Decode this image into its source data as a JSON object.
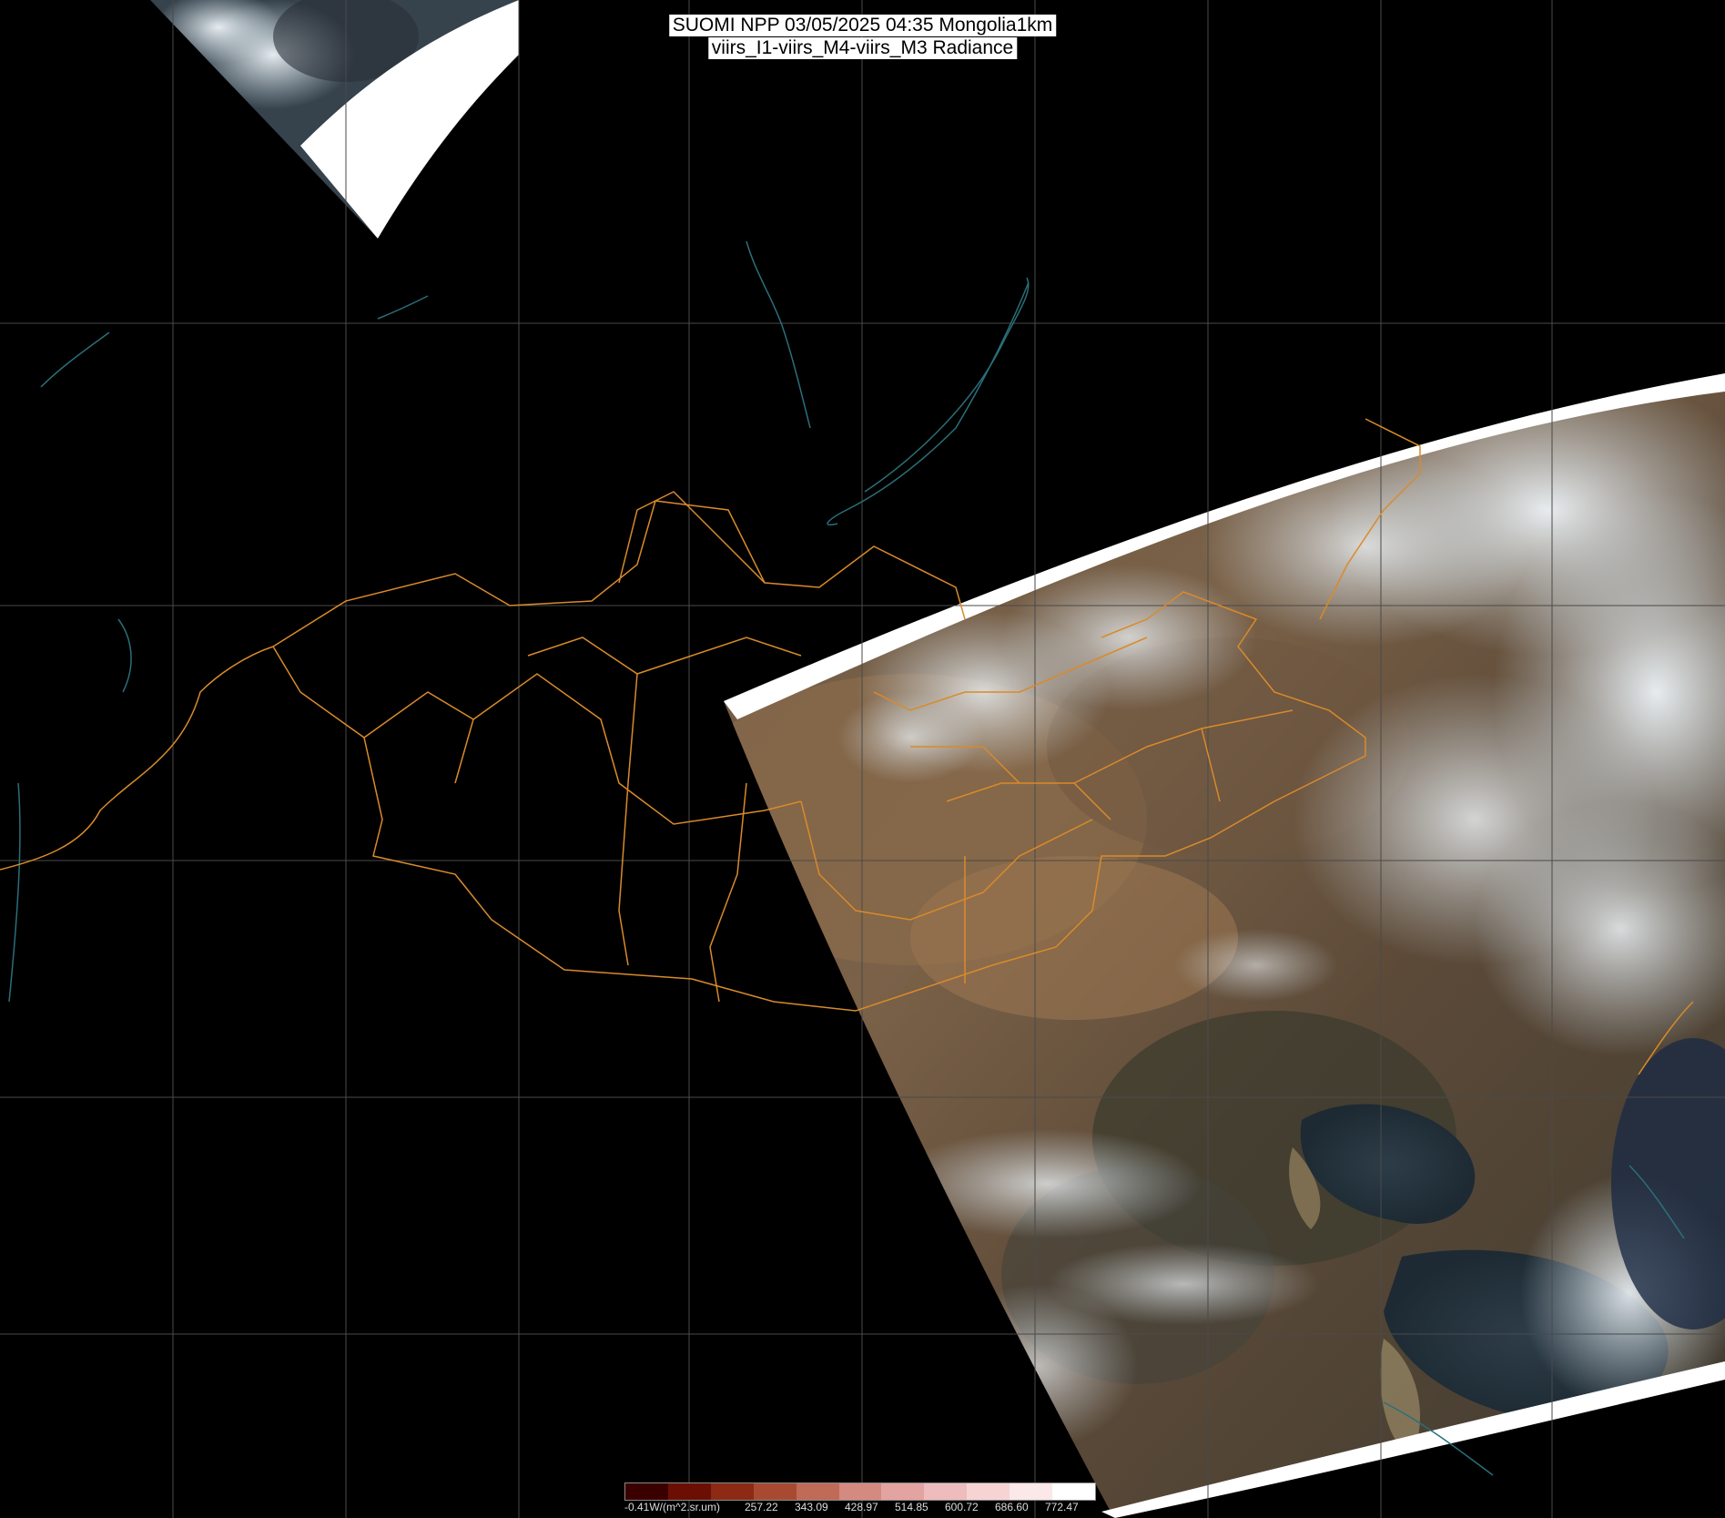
{
  "title": {
    "line1": "SUOMI NPP 03/05/2025 04:35 Mongolia1km",
    "line2": "viirs_I1-viirs_M4-viirs_M3 Radiance"
  },
  "colors": {
    "background": "#000000",
    "grid": "#4a4a4a",
    "borders": "#d98a2b",
    "coast": "#2a6f7a",
    "swath_edge": "#ffffff"
  },
  "legend": {
    "colors": [
      "#3a0000",
      "#6b0f05",
      "#8c2a14",
      "#a84a32",
      "#c06a58",
      "#d48a80",
      "#e3a3a0",
      "#eebcbc",
      "#f6d4d4",
      "#fbe8e8",
      "#ffffff"
    ],
    "labels": [
      "-0.41W/(m^2.sr.um)",
      "257.22",
      "343.09",
      "428.97",
      "514.85",
      "600.72",
      "686.60",
      "772.47"
    ]
  }
}
